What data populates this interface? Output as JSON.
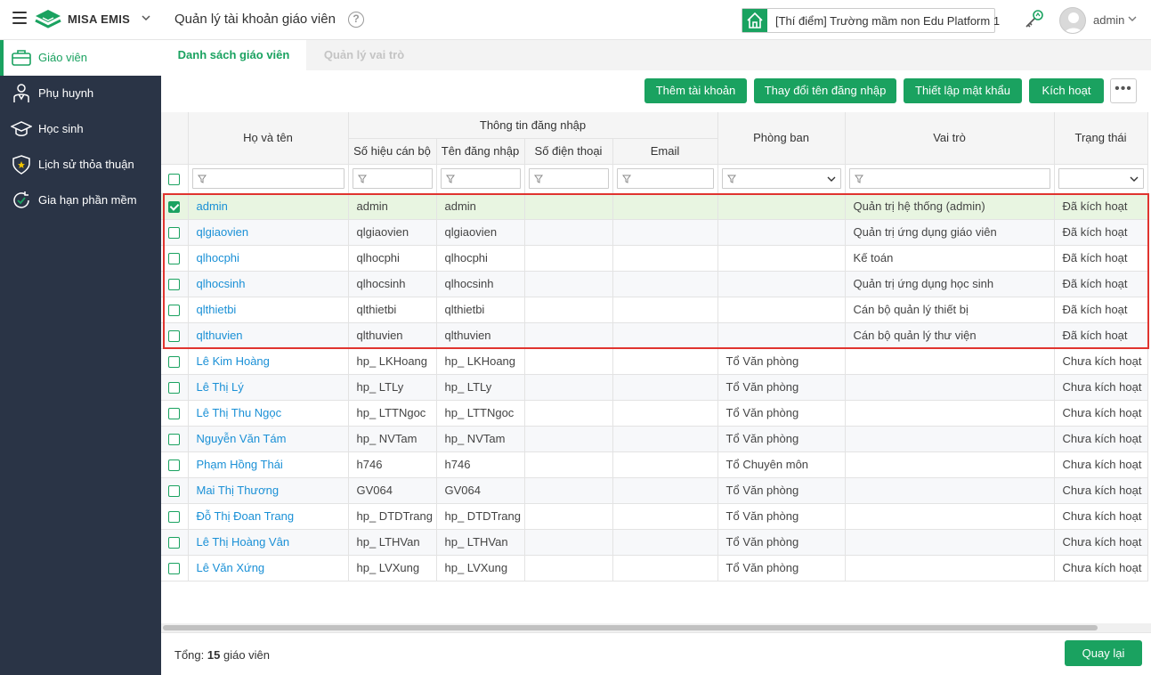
{
  "header": {
    "brand": "MISA EMIS",
    "page_title": "Quản lý tài khoản giáo viên",
    "school": "[Thí điểm] Trường mầm non Edu Platform 1",
    "user": "admin",
    "accent": "#1aa260"
  },
  "sidebar": {
    "items": [
      {
        "label": "Giáo viên",
        "icon": "briefcase-icon",
        "active": true
      },
      {
        "label": "Phụ huynh",
        "icon": "parent-icon"
      },
      {
        "label": "Học sinh",
        "icon": "graduation-cap-icon"
      },
      {
        "label": "Lịch sử thỏa thuận",
        "icon": "shield-star-icon"
      },
      {
        "label": "Gia hạn phần mềm",
        "icon": "renew-check-icon"
      }
    ]
  },
  "tabs": [
    {
      "label": "Danh sách giáo viên",
      "active": true
    },
    {
      "label": "Quản lý vai trò",
      "active": false
    }
  ],
  "actions": {
    "add": "Thêm tài khoản",
    "rename": "Thay đổi tên đăng nhập",
    "password": "Thiết lập mật khẩu",
    "activate": "Kích hoạt",
    "more": "•••"
  },
  "table": {
    "headers": {
      "name": "Họ và tên",
      "login_group": "Thông tin đăng nhập",
      "staff_id": "Số hiệu cán bộ",
      "username": "Tên đăng nhập",
      "phone": "Số điện thoại",
      "email": "Email",
      "department": "Phòng ban",
      "role": "Vai trò",
      "status": "Trạng thái"
    },
    "rows": [
      {
        "name": "admin",
        "staff_id": "admin",
        "username": "admin",
        "phone": "",
        "email": "",
        "department": "",
        "role": "Quản trị hệ thống (admin)",
        "status": "Đã kích hoạt",
        "checked": true
      },
      {
        "name": "qlgiaovien",
        "staff_id": "qlgiaovien",
        "username": "qlgiaovien",
        "phone": "",
        "email": "",
        "department": "",
        "role": "Quản trị ứng dụng giáo viên",
        "status": "Đã kích hoạt"
      },
      {
        "name": "qlhocphi",
        "staff_id": "qlhocphi",
        "username": "qlhocphi",
        "phone": "",
        "email": "",
        "department": "",
        "role": "Kế toán",
        "status": "Đã kích hoạt"
      },
      {
        "name": "qlhocsinh",
        "staff_id": "qlhocsinh",
        "username": "qlhocsinh",
        "phone": "",
        "email": "",
        "department": "",
        "role": "Quản trị ứng dụng học sinh",
        "status": "Đã kích hoạt"
      },
      {
        "name": "qlthietbi",
        "staff_id": "qlthietbi",
        "username": "qlthietbi",
        "phone": "",
        "email": "",
        "department": "",
        "role": "Cán bộ quản lý thiết bị",
        "status": "Đã kích hoạt"
      },
      {
        "name": "qlthuvien",
        "staff_id": "qlthuvien",
        "username": "qlthuvien",
        "phone": "",
        "email": "",
        "department": "",
        "role": "Cán bộ quản lý thư viện",
        "status": "Đã kích hoạt"
      },
      {
        "name": "Lê Kim Hoàng",
        "staff_id": "hp_ LKHoang",
        "username": "hp_ LKHoang",
        "phone": "",
        "email": "",
        "department": "Tổ Văn phòng",
        "role": "",
        "status": "Chưa kích hoạt"
      },
      {
        "name": "Lê Thị Lý",
        "staff_id": "hp_ LTLy",
        "username": "hp_ LTLy",
        "phone": "",
        "email": "",
        "department": "Tổ Văn phòng",
        "role": "",
        "status": "Chưa kích hoạt"
      },
      {
        "name": "Lê Thị Thu Ngọc",
        "staff_id": "hp_ LTTNgoc",
        "username": "hp_ LTTNgoc",
        "phone": "",
        "email": "",
        "department": "Tổ Văn phòng",
        "role": "",
        "status": "Chưa kích hoạt"
      },
      {
        "name": "Nguyễn Văn Tám",
        "staff_id": "hp_ NVTam",
        "username": "hp_ NVTam",
        "phone": "",
        "email": "",
        "department": "Tổ Văn phòng",
        "role": "",
        "status": "Chưa kích hoạt"
      },
      {
        "name": "Phạm Hồng Thái",
        "staff_id": "h746",
        "username": "h746",
        "phone": "",
        "email": "",
        "department": "Tổ Chuyên môn",
        "role": "",
        "status": "Chưa kích hoạt"
      },
      {
        "name": "Mai Thị Thương",
        "staff_id": "GV064",
        "username": "GV064",
        "phone": "",
        "email": "",
        "department": "Tổ Văn phòng",
        "role": "",
        "status": "Chưa kích hoạt"
      },
      {
        "name": "Đỗ Thị Đoan Trang",
        "staff_id": "hp_ DTDTrang",
        "username": "hp_ DTDTrang",
        "phone": "",
        "email": "",
        "department": "Tổ Văn phòng",
        "role": "",
        "status": "Chưa kích hoạt"
      },
      {
        "name": "Lê Thị Hoàng Vân",
        "staff_id": "hp_ LTHVan",
        "username": "hp_ LTHVan",
        "phone": "",
        "email": "",
        "department": "Tổ Văn phòng",
        "role": "",
        "status": "Chưa kích hoạt"
      },
      {
        "name": "Lê Văn Xứng",
        "staff_id": "hp_ LVXung",
        "username": "hp_ LVXung",
        "phone": "",
        "email": "",
        "department": "Tổ Văn phòng",
        "role": "",
        "status": "Chưa kích hoạt"
      }
    ]
  },
  "footer": {
    "total_prefix": "Tổng:",
    "total_count": "15",
    "total_suffix": "giáo viên",
    "back": "Quay lại"
  }
}
